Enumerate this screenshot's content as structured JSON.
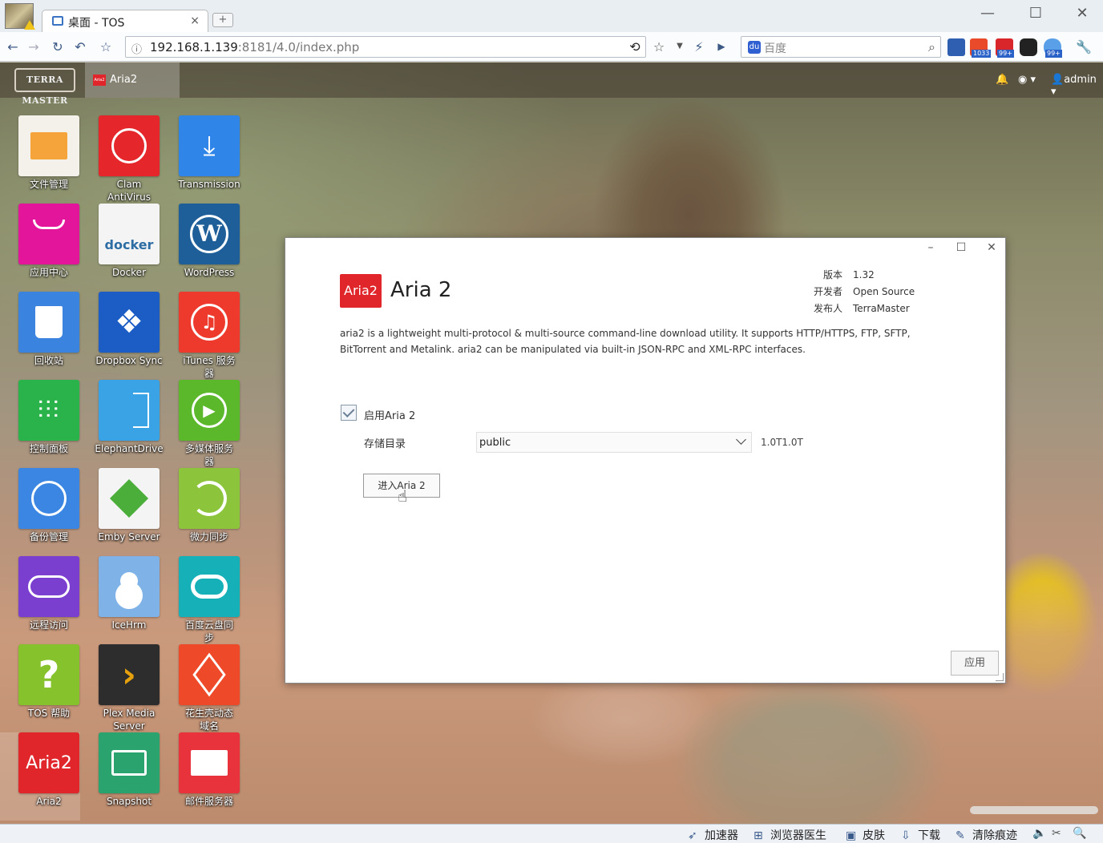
{
  "browser": {
    "tab_title": "桌面 - TOS",
    "tab_close": "×",
    "new_tab": "+",
    "url_main": "192.168.1.139",
    "url_rest": ":8181/4.0/index.php",
    "search_placeholder": "百度",
    "window": {
      "min": "—",
      "max": "☐",
      "close": "✕"
    },
    "nav": {
      "back": "←",
      "forward": "→",
      "refresh": "↻",
      "undo": "↶",
      "home": "☆"
    },
    "ext_badges": {
      "weibo": "1033",
      "mail": "99+",
      "cloud": "99+"
    }
  },
  "tos": {
    "logo": "TERRA MASTER",
    "open_app": "Aria2",
    "open_app_icon": "Aria2",
    "user": "admin"
  },
  "desktop_icons": [
    {
      "label": "文件管理",
      "icon": "folder-icon",
      "color": "#f4f1ea"
    },
    {
      "label": "Clam\nAntiVirus",
      "icon": "clamav-icon",
      "color": "#e5262b"
    },
    {
      "label": "Transmission",
      "icon": "download-icon",
      "color": "#2f86e8"
    },
    {
      "label": "应用中心",
      "icon": "bag-icon",
      "color": "#e3159a"
    },
    {
      "label": "Docker",
      "icon": "docker-icon",
      "color": "#f4f4f4"
    },
    {
      "label": "WordPress",
      "icon": "wordpress-icon",
      "color": "#1f5f99"
    },
    {
      "label": "回收站",
      "icon": "recycle-bin-icon",
      "color": "#3a84e0"
    },
    {
      "label": "Dropbox Sync",
      "icon": "dropbox-icon",
      "color": "#1b5dc4"
    },
    {
      "label": "iTunes 服务\n器",
      "icon": "music-icon",
      "color": "#ee3a2c"
    },
    {
      "label": "控制面板",
      "icon": "sliders-icon",
      "color": "#2ab34a"
    },
    {
      "label": "ElephantDrive",
      "icon": "elephantdrive-icon",
      "color": "#3aa3e6"
    },
    {
      "label": "多媒体服务\n器",
      "icon": "play-icon",
      "color": "#5bb82a"
    },
    {
      "label": "备份管理",
      "icon": "clock-icon",
      "color": "#3a86e2"
    },
    {
      "label": "Emby Server",
      "icon": "emby-icon",
      "color": "#f4f4f4"
    },
    {
      "label": "微力同步",
      "icon": "sync-icon",
      "color": "#8cc43c"
    },
    {
      "label": "远程访问",
      "icon": "cloud-icon",
      "color": "#7b3fd0"
    },
    {
      "label": "IceHrm",
      "icon": "person-icon",
      "color": "#7fb3e8"
    },
    {
      "label": "百度云盘同\n步",
      "icon": "baidu-cloud-icon",
      "color": "#15b0b8"
    },
    {
      "label": "TOS 帮助",
      "icon": "help-icon",
      "color": "#86c22c"
    },
    {
      "label": "Plex Media\nServer",
      "icon": "plex-icon",
      "color": "#2d2d2d"
    },
    {
      "label": "花生壳动态\n域名",
      "icon": "box-icon",
      "color": "#ee4a2a"
    },
    {
      "label": "Aria2",
      "icon": "aria2-icon",
      "color": "#e0262b"
    },
    {
      "label": "Snapshot",
      "icon": "snapshot-icon",
      "color": "#2aa36e"
    },
    {
      "label": "邮件服务器",
      "icon": "mail-icon",
      "color": "#e8333c"
    }
  ],
  "dialog": {
    "app_icon_text": "Aria2",
    "title": "Aria 2",
    "controls": {
      "min": "–",
      "max": "☐",
      "close": "✕"
    },
    "meta": [
      {
        "key": "版本",
        "value": "1.32"
      },
      {
        "key": "开发者",
        "value": "Open Source"
      },
      {
        "key": "发布人",
        "value": "TerraMaster"
      }
    ],
    "description": "aria2 is a lightweight multi-protocol & multi-source command-line download utility. It supports HTTP/HTTPS, FTP, SFTP, BitTorrent and Metalink. aria2 can be manipulated via built-in JSON-RPC and XML-RPC interfaces.",
    "enable_label": "启用Aria 2",
    "enable_checked": true,
    "storage_label": "存储目录",
    "storage_value": "public",
    "capacity": "1.0T1.0T",
    "enter_button": "进入Aria 2",
    "apply_button": "应用"
  },
  "statusbar": [
    {
      "label": "加速器",
      "icon": "accelerator-icon"
    },
    {
      "label": "浏览器医生",
      "icon": "doctor-icon"
    },
    {
      "label": "皮肤",
      "icon": "skin-icon"
    },
    {
      "label": "下载",
      "icon": "download-icon"
    },
    {
      "label": "清除痕迹",
      "icon": "broom-icon"
    }
  ],
  "statusbar_zoom": "🔍"
}
